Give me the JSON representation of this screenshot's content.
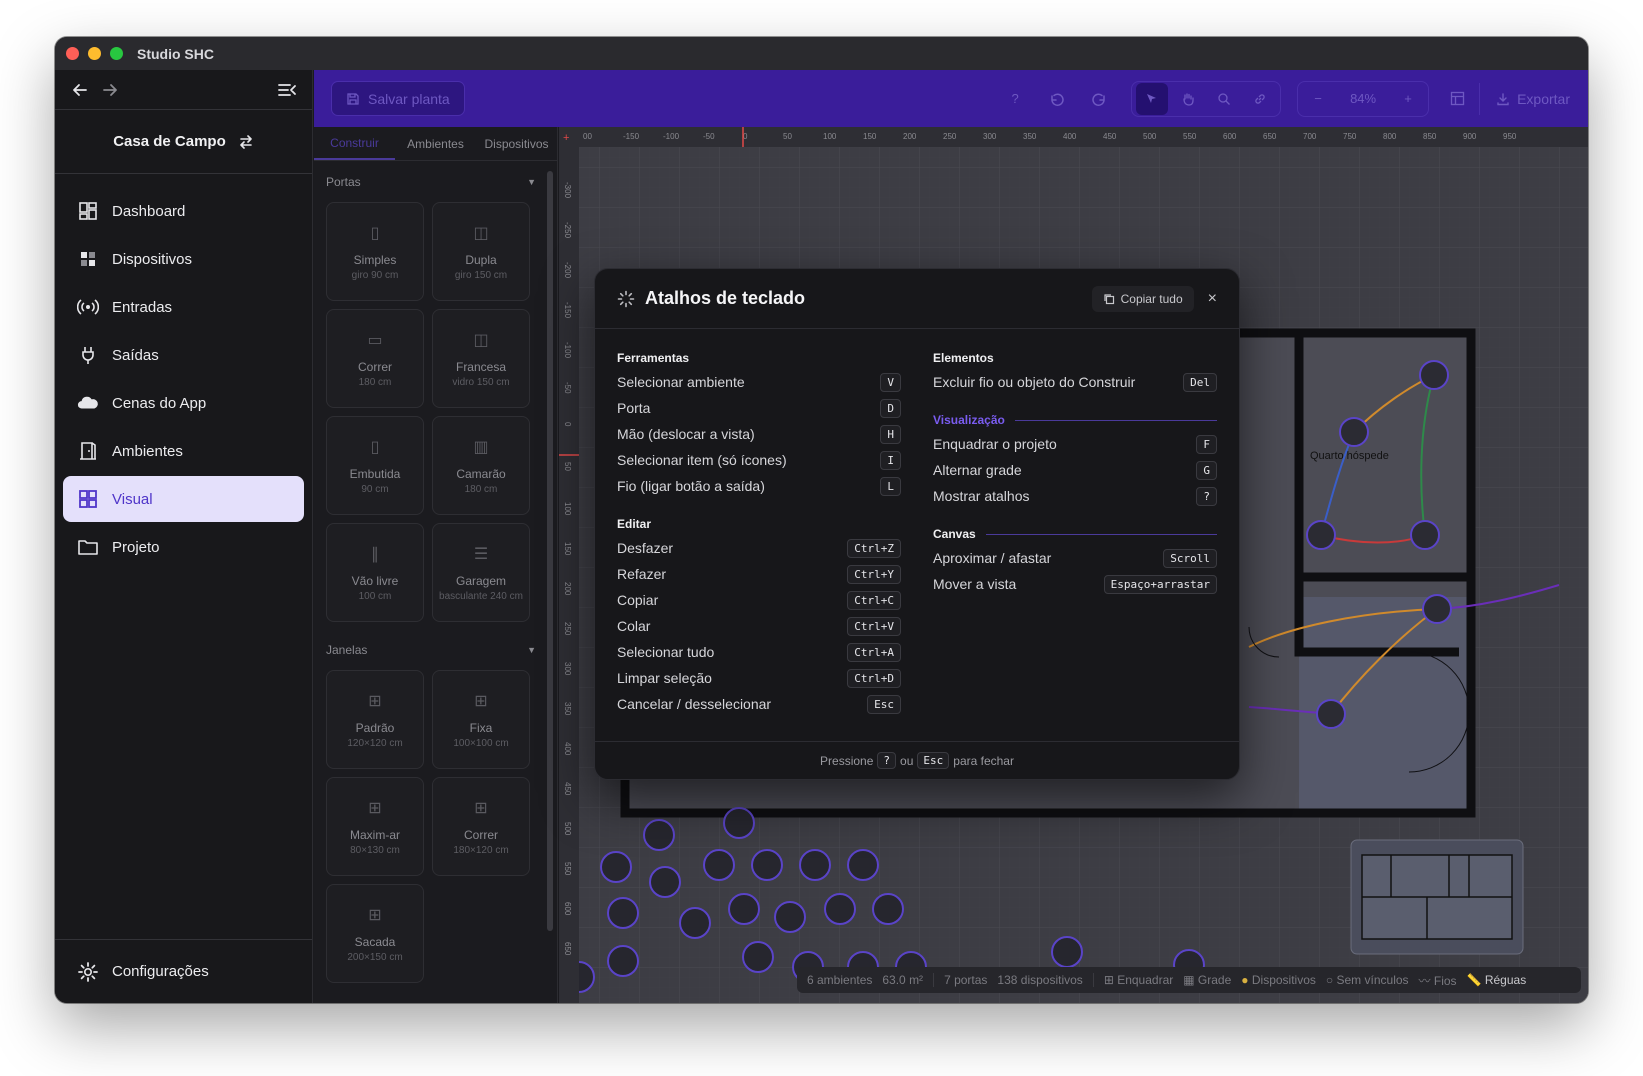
{
  "app": {
    "title": "Studio SHC"
  },
  "sidebar": {
    "project_name": "Casa de Campo",
    "items": [
      {
        "label": "Dashboard",
        "icon": "dashboard-icon"
      },
      {
        "label": "Dispositivos",
        "icon": "devices-icon"
      },
      {
        "label": "Entradas",
        "icon": "broadcast-icon"
      },
      {
        "label": "Saídas",
        "icon": "plug-icon"
      },
      {
        "label": "Cenas do App",
        "icon": "cloud-icon"
      },
      {
        "label": "Ambientes",
        "icon": "door-icon"
      },
      {
        "label": "Visual",
        "icon": "grid-icon",
        "active": true
      },
      {
        "label": "Projeto",
        "icon": "folder-icon"
      }
    ],
    "settings_label": "Configurações"
  },
  "toolbar": {
    "save_label": "Salvar planta",
    "help_label": "?",
    "zoom_value": "84%",
    "export_label": "Exportar"
  },
  "panel": {
    "tabs": [
      "Construir",
      "Ambientes",
      "Dispositivos"
    ],
    "active_tab": "Construir",
    "doors_heading": "Portas",
    "doors": [
      {
        "title": "Simples",
        "sub": "giro 90 cm"
      },
      {
        "title": "Dupla",
        "sub": "giro 150 cm"
      },
      {
        "title": "Correr",
        "sub": "180 cm"
      },
      {
        "title": "Francesa",
        "sub": "vidro 150 cm"
      },
      {
        "title": "Embutida",
        "sub": "90 cm"
      },
      {
        "title": "Camarão",
        "sub": "180 cm"
      },
      {
        "title": "Vão livre",
        "sub": "100 cm"
      },
      {
        "title": "Garagem",
        "sub": "basculante 240 cm"
      }
    ],
    "windows_heading": "Janelas",
    "windows": [
      {
        "title": "Padrão",
        "sub": "120×120 cm"
      },
      {
        "title": "Fixa",
        "sub": "100×100 cm"
      },
      {
        "title": "Maxim-ar",
        "sub": "80×130 cm"
      },
      {
        "title": "Correr",
        "sub": "180×120 cm"
      },
      {
        "title": "Sacada",
        "sub": "200×150 cm"
      }
    ]
  },
  "canvas": {
    "ruler_x": [
      "00",
      "-150",
      "-100",
      "-50",
      "0",
      "50",
      "100",
      "150",
      "200",
      "250",
      "300",
      "350",
      "400",
      "450",
      "500",
      "550",
      "600",
      "650",
      "700",
      "750",
      "800",
      "850",
      "900",
      "950"
    ],
    "ruler_y": [
      "-300",
      "-250",
      "-200",
      "-150",
      "-100",
      "-50",
      "0",
      "50",
      "100",
      "150",
      "200",
      "250",
      "300",
      "350",
      "400",
      "450",
      "500",
      "550",
      "600",
      "650"
    ],
    "room_label": "Quarto hóspede"
  },
  "modal": {
    "title": "Atalhos de teclado",
    "copy_label": "Copiar tudo",
    "close_label": "×",
    "left": [
      {
        "heading": "Ferramentas",
        "rows": [
          {
            "label": "Selecionar ambiente",
            "key": "V"
          },
          {
            "label": "Porta",
            "key": "D"
          },
          {
            "label": "Mão (deslocar a vista)",
            "key": "H"
          },
          {
            "label": "Selecionar item (só ícones)",
            "key": "I"
          },
          {
            "label": "Fio (ligar botão a saída)",
            "key": "L"
          }
        ]
      },
      {
        "heading": "Editar",
        "rows": [
          {
            "label": "Desfazer",
            "key": "Ctrl+Z"
          },
          {
            "label": "Refazer",
            "key": "Ctrl+Y"
          },
          {
            "label": "Copiar",
            "key": "Ctrl+C"
          },
          {
            "label": "Colar",
            "key": "Ctrl+V"
          },
          {
            "label": "Selecionar tudo",
            "key": "Ctrl+A"
          },
          {
            "label": "Limpar seleção",
            "key": "Ctrl+D"
          },
          {
            "label": "Cancelar / desselecionar",
            "key": "Esc"
          }
        ]
      }
    ],
    "right": [
      {
        "heading": "Elementos",
        "rows": [
          {
            "label": "Excluir fio ou objeto do Construir",
            "key": "Del"
          }
        ]
      },
      {
        "heading": "Visualização",
        "rows": [
          {
            "label": "Enquadrar o projeto",
            "key": "F"
          },
          {
            "label": "Alternar grade",
            "key": "G"
          },
          {
            "label": "Mostrar atalhos",
            "key": "?"
          }
        ]
      },
      {
        "heading": "Canvas",
        "rows": [
          {
            "label": "Aproximar / afastar",
            "key": "Scroll"
          },
          {
            "label": "Mover a vista",
            "key": "Espaço+arrastar"
          }
        ]
      }
    ],
    "footer_before": "Pressione",
    "footer_key1": "?",
    "footer_mid": "ou",
    "footer_key2": "Esc",
    "footer_after": "para fechar"
  },
  "statusbar": {
    "rooms": "6 ambientes",
    "area": "63.0 m²",
    "doors": "7 portas",
    "devices": "138 dispositivos",
    "fit": "Enquadrar",
    "grid": "Grade",
    "devices_toggle": "Dispositivos",
    "no_links": "Sem vínculos",
    "wires": "Fios",
    "rulers": "Réguas"
  },
  "colors": {
    "accent": "#3a1d9a",
    "active_bg": "#e4e0fb",
    "active_text": "#4f35c9"
  }
}
